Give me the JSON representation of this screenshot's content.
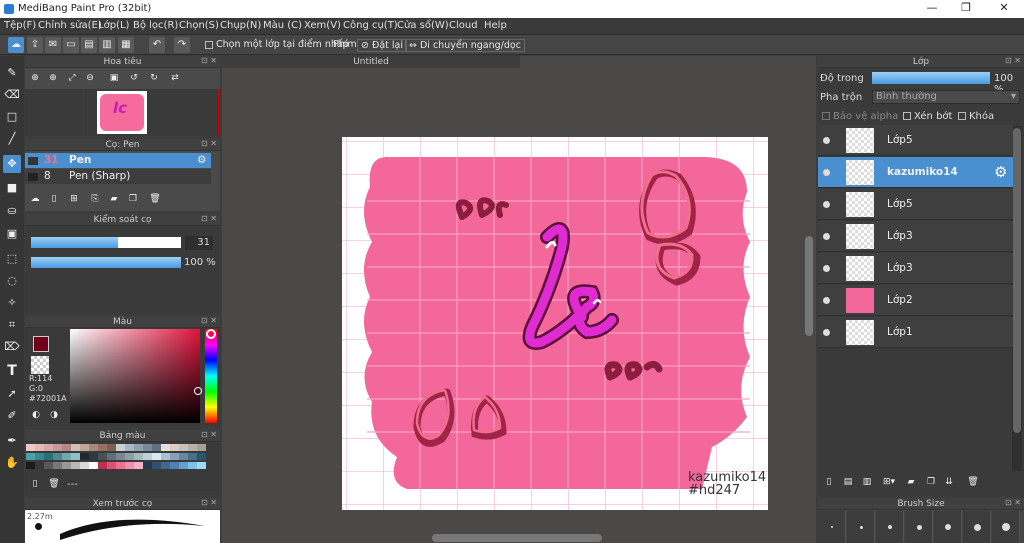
{
  "window": {
    "title": "MediBang Paint Pro (32bit)",
    "controls": [
      "—",
      "❐",
      "✕"
    ]
  },
  "menu": [
    "Tệp(F)",
    "Chỉnh sửa(E)",
    "Lớp(L)",
    "Bộ lọc(R)",
    "Chọn(S)",
    "Chụp(N)",
    "Màu (C)",
    "Xem(V)",
    "Công cụ(T)",
    "Cửa sổ(W)",
    "Cloud",
    "Help"
  ],
  "toolbar": {
    "select_one_layer": "Chọn một lớp tại điểm nhấp",
    "keys_label": "Phím",
    "reset_label": "Đặt lại",
    "flip_label": "Di chuyển ngang/dọc"
  },
  "navigator": {
    "title": "Hoa tiêu"
  },
  "brush_panel": {
    "title": "Cọ: Pen",
    "items": [
      {
        "size": "31",
        "name": "Pen"
      },
      {
        "size": "8",
        "name": "Pen (Sharp)"
      }
    ]
  },
  "brush_control": {
    "title": "Kiểm soát cọ",
    "size_value": "31",
    "size_fraction": 0.58,
    "opacity_value": "100 %",
    "opacity_fraction": 1.0
  },
  "color_panel": {
    "title": "Màu",
    "r": "R:114",
    "g": "G:0",
    "hex": "#72001A",
    "fg": "#72001A"
  },
  "palette_panel": {
    "title": "Bảng màu",
    "more": "---"
  },
  "preview_panel": {
    "title": "Xem trước cọ",
    "size": "2.27m"
  },
  "canvas": {
    "tab": "Untitled",
    "signature_line1": "kazumiko14",
    "signature_line2": "#hd247",
    "text_main": "lc"
  },
  "layer_panel": {
    "title": "Lớp",
    "opacity_label": "Độ trong",
    "opacity_value": "100 %",
    "opacity_fraction": 1.0,
    "blend_label": "Pha trộn",
    "blend_value": "Bình thường",
    "alpha_protect": "Bảo vệ alpha",
    "clip": "Xén bớt",
    "lock": "Khóa",
    "layers": [
      {
        "name": "Lớp5"
      },
      {
        "name": "kazumiko14"
      },
      {
        "name": "Lớp5"
      },
      {
        "name": "Lớp3"
      },
      {
        "name": "Lớp3"
      },
      {
        "name": "Lớp2"
      },
      {
        "name": "Lớp1"
      }
    ]
  },
  "brush_size_panel": {
    "title": "Brush Size"
  }
}
